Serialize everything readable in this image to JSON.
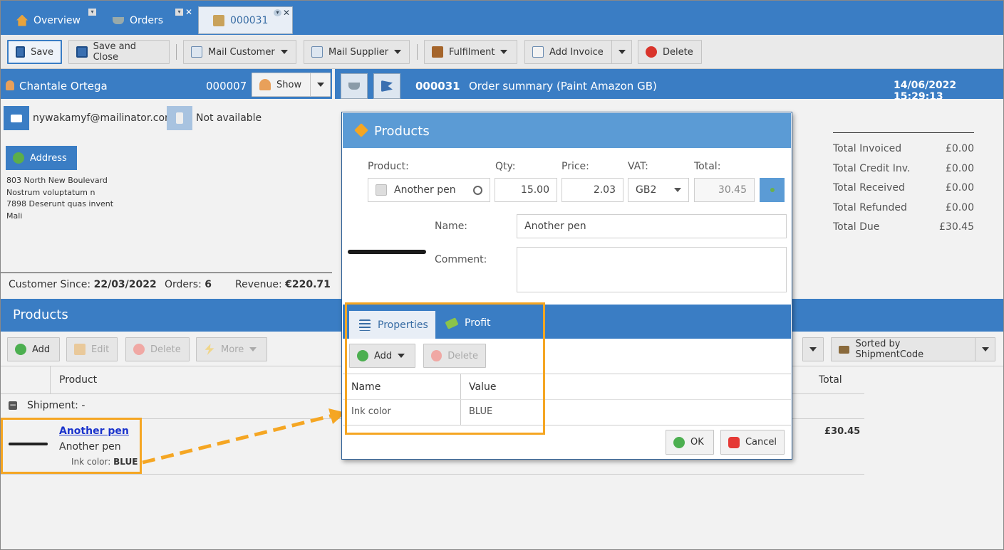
{
  "tabs": [
    {
      "label": "Overview",
      "icon": "home-icon"
    },
    {
      "label": "Orders",
      "icon": "basket-icon"
    },
    {
      "label": "000031",
      "icon": "order-icon"
    }
  ],
  "toolbar": {
    "save": "Save",
    "save_close": "Save and Close",
    "mail_customer": "Mail Customer",
    "mail_supplier": "Mail Supplier",
    "fulfilment": "Fulfilment",
    "add_invoice": "Add Invoice",
    "delete": "Delete"
  },
  "customer": {
    "name": "Chantale Ortega",
    "number": "000007",
    "show": "Show",
    "email": "nywakamyf@mailinator.com",
    "phone": "Not available",
    "address_btn": "Address",
    "address_lines": [
      "803 North New Boulevard",
      "Nostrum voluptatum n",
      "7898 Deserunt quas invent",
      "Mali"
    ],
    "since_label": "Customer Since:",
    "since": "22/03/2022",
    "orders_label": "Orders:",
    "orders": "6",
    "revenue_label": "Revenue:",
    "revenue": "€220.71"
  },
  "order": {
    "number": "000031",
    "summary": "Order summary (Paint Amazon GB)",
    "datetime": "14/06/2022 15:29:13"
  },
  "totals": [
    {
      "label": "Total Invoiced",
      "value": "£0.00"
    },
    {
      "label": "Total Credit Inv.",
      "value": "£0.00"
    },
    {
      "label": "Total Received",
      "value": "£0.00"
    },
    {
      "label": "Total Refunded",
      "value": "£0.00"
    },
    {
      "label": "Total Due",
      "value": "£30.45"
    }
  ],
  "products_section": {
    "title": "Products",
    "add": "Add",
    "edit": "Edit",
    "delete": "Delete",
    "more": "More",
    "sorted": "Sorted by ShipmentCode",
    "col_product": "Product",
    "col_total": "Total",
    "shipment": "Shipment: -",
    "item": {
      "name": "Another pen",
      "desc": "Another pen",
      "prop_label": "Ink color:",
      "prop_value": "BLUE",
      "total": "£30.45"
    }
  },
  "dialog": {
    "title": "Products",
    "product_label": "Product:",
    "product_value": "Another pen",
    "qty_label": "Qty:",
    "qty": "15.00",
    "price_label": "Price:",
    "price": "2.03",
    "vat_label": "VAT:",
    "vat": "GB2",
    "total_label": "Total:",
    "total": "30.45",
    "name_label": "Name:",
    "name_value": "Another pen",
    "comment_label": "Comment:",
    "tab_properties": "Properties",
    "tab_profit": "Profit",
    "add": "Add",
    "delete": "Delete",
    "col_name": "Name",
    "col_value": "Value",
    "rows": [
      {
        "name": "Ink color",
        "value": "BLUE"
      }
    ],
    "ok": "OK",
    "cancel": "Cancel"
  },
  "colors": {
    "accent": "#3a7dc4",
    "highlight": "#f5a623"
  }
}
